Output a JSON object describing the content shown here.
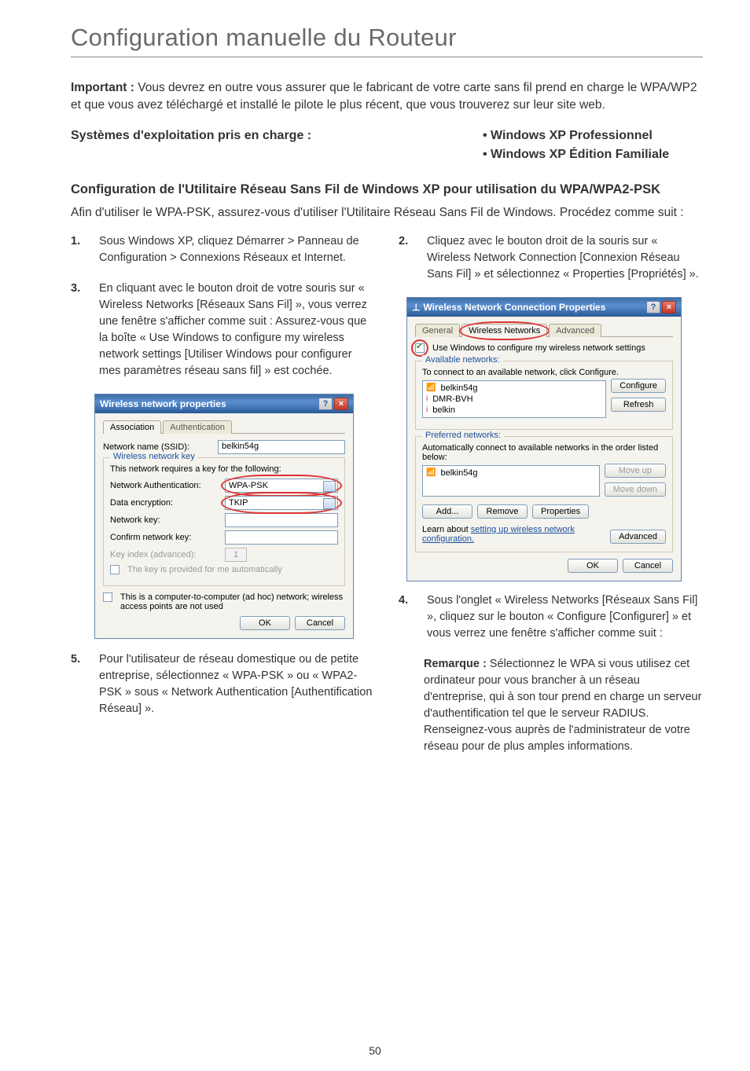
{
  "page": {
    "title": "Configuration manuelle du Routeur",
    "number": "50"
  },
  "intro": {
    "label": "Important :",
    "text": " Vous devrez en outre vous assurer que le fabricant de votre carte sans fil prend en charge le WPA/WP2 et que vous avez téléchargé et installé le pilote le plus récent, que vous trouverez sur leur site web."
  },
  "os_section": {
    "left": "Systèmes d'exploitation pris en charge :",
    "right1": "• Windows XP Professionnel",
    "right2": "• Windows XP Édition Familiale"
  },
  "config_heading": "Configuration de l'Utilitaire Réseau Sans Fil de Windows XP pour utilisation du WPA/WPA2-PSK",
  "config_intro": "Afin d'utiliser le WPA-PSK, assurez-vous d'utiliser l'Utilitaire Réseau Sans Fil de Windows. Procédez comme suit :",
  "steps": {
    "s1": {
      "num": "1.",
      "text": "Sous Windows XP, cliquez Démarrer > Panneau de Configuration > Connexions Réseaux et Internet."
    },
    "s2": {
      "num": "2.",
      "text": "Cliquez avec le bouton droit de la souris sur « Wireless Network Connection [Connexion Réseau Sans Fil] » et sélectionnez « Properties [Propriétés] »."
    },
    "s3": {
      "num": "3.",
      "text": "En cliquant avec le bouton droit de votre souris sur « Wireless Networks [Réseaux Sans Fil] », vous verrez une fenêtre s'afficher comme suit : Assurez-vous que la boîte « Use Windows to configure my wireless network settings [Utiliser Windows pour configurer mes paramètres réseau sans fil] » est cochée."
    },
    "s4": {
      "num": "4.",
      "text": "Sous l'onglet « Wireless Networks [Réseaux Sans Fil] », cliquez sur le bouton « Configure [Configurer] » et vous verrez une fenêtre s'afficher comme suit :"
    },
    "s5": {
      "num": "5.",
      "text": "Pour l'utilisateur de réseau domestique ou de petite entreprise, sélectionnez « WPA-PSK » ou « WPA2-PSK » sous « Network Authentication [Authentification Réseau] »."
    }
  },
  "note": {
    "label": "Remarque :",
    "text": " Sélectionnez le WPA si vous utilisez cet ordinateur pour vous brancher à un réseau d'entreprise, qui à son tour prend en charge un serveur d'authentification tel que le serveur RADIUS. Renseignez-vous auprès de l'administrateur de votre réseau pour de plus amples informations."
  },
  "dialog1": {
    "title": "Wireless network properties",
    "tab_assoc": "Association",
    "tab_auth": "Authentication",
    "ssid_label": "Network name (SSID):",
    "ssid_value": "belkin54g",
    "group_key": "Wireless network key",
    "key_req": "This network requires a key for the following:",
    "netauth_label": "Network Authentication:",
    "netauth_value": "WPA-PSK",
    "dataenc_label": "Data encryption:",
    "dataenc_value": "TKIP",
    "netkey_label": "Network key:",
    "confkey_label": "Confirm network key:",
    "keyindex_label": "Key index (advanced):",
    "keyindex_value": "1",
    "auto_key": "The key is provided for me automatically",
    "adhoc": "This is a computer-to-computer (ad hoc) network; wireless access points are not used",
    "ok": "OK",
    "cancel": "Cancel"
  },
  "dialog2": {
    "title": "Wireless Network Connection Properties",
    "tab_general": "General",
    "tab_wireless": "Wireless Networks",
    "tab_advanced": "Advanced",
    "use_windows": "Use Windows to configure my wireless network settings",
    "avail_legend": "Available networks:",
    "avail_hint": "To connect to an available network, click Configure.",
    "net_a": "belkin54g",
    "net_b": "DMR-BVH",
    "net_c": "belkin",
    "btn_configure": "Configure",
    "btn_refresh": "Refresh",
    "pref_legend": "Preferred networks:",
    "pref_hint": "Automatically connect to available networks in the order listed below:",
    "pref_item": "belkin54g",
    "btn_moveup": "Move up",
    "btn_movedown": "Move down",
    "btn_add": "Add...",
    "btn_remove": "Remove",
    "btn_properties": "Properties",
    "learn_pre": "Learn about ",
    "learn_link": "setting up wireless network configuration.",
    "btn_advanced": "Advanced",
    "ok": "OK",
    "cancel": "Cancel"
  }
}
